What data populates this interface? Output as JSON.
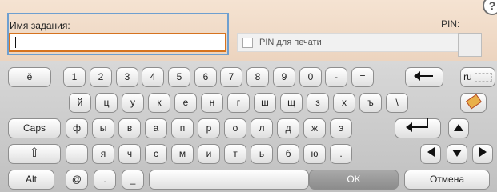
{
  "job_name": {
    "label": "Имя задания:",
    "value": ""
  },
  "pin_print": {
    "label": "PIN для печати",
    "checked": false
  },
  "pin": {
    "label": "PIN:"
  },
  "help_symbol": "?",
  "keys": {
    "row1": [
      "ё",
      "1",
      "2",
      "3",
      "4",
      "5",
      "6",
      "7",
      "8",
      "9",
      "0",
      "-",
      "="
    ],
    "row2": [
      "й",
      "ц",
      "у",
      "к",
      "е",
      "н",
      "г",
      "ш",
      "щ",
      "з",
      "х",
      "ъ",
      "\\"
    ],
    "row3": [
      "ф",
      "ы",
      "в",
      "а",
      "п",
      "р",
      "о",
      "л",
      "д",
      "ж",
      "э"
    ],
    "row4": [
      "я",
      "ч",
      "с",
      "м",
      "и",
      "т",
      "ь",
      "б",
      "ю",
      "."
    ],
    "caps_label": "Caps",
    "alt_label": "Alt",
    "at_label": "@",
    "dot_label": ".",
    "underscore_label": "_",
    "lang_label": "ru",
    "ok_label": "OK",
    "cancel_label": "Отмена"
  },
  "icons": {
    "backspace": "backspace-icon",
    "enter": "enter-icon",
    "shift": "shift-icon",
    "clear": "eraser-icon",
    "arrows": [
      "arrow-up-icon",
      "arrow-left-icon",
      "arrow-down-icon",
      "arrow-right-icon"
    ]
  },
  "colors": {
    "focus_border": "#d6731f",
    "field_border": "#6e9fd0",
    "header_bg": "#f0dcc8"
  }
}
